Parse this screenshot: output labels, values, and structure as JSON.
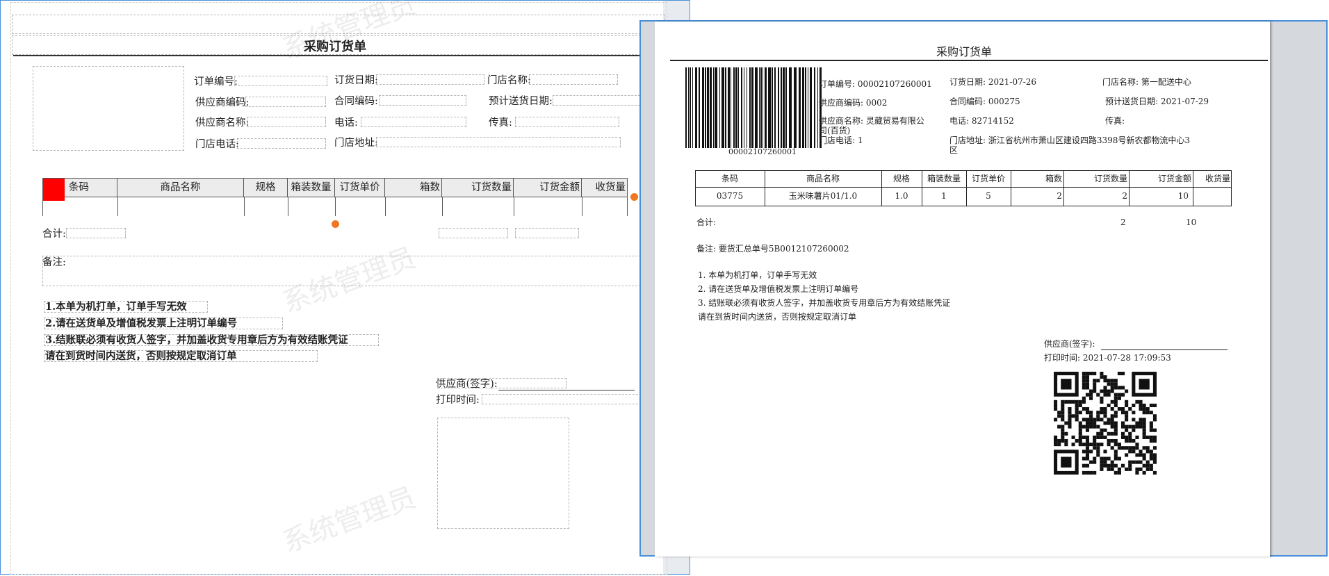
{
  "designer": {
    "title": "采购订货单",
    "watermark": "系统管理员",
    "header_fields": {
      "order_no": "订单编号:",
      "order_date": "订货日期:",
      "store_name": "门店名称:",
      "supplier_code": "供应商编码:",
      "contract_code": "合同编码:",
      "expected_date": "预计送货日期:",
      "supplier_name": "供应商名称:",
      "phone": "电话:",
      "fax": "传真:",
      "store_phone": "门店电话:",
      "store_address": "门店地址:"
    },
    "columns": [
      "条码",
      "商品名称",
      "规格",
      "箱装数量",
      "订货单价",
      "箱数",
      "订货数量",
      "订货金额",
      "收货量"
    ],
    "total_label": "合计:",
    "remark_label": "备注:",
    "notes": [
      "1.本单为机打单，订单手写无效",
      "2.请在送货单及增值税发票上注明订单编号",
      "3.结账联必须有收货人签字，并加盖收货专用章后方为有效结账凭证",
      "请在到货时间内送货，否则按规定取消订单"
    ],
    "supplier_sign": "供应商(签字):",
    "print_time": "打印时间:"
  },
  "preview": {
    "title": "采购订货单",
    "barcode_number": "00002107260001",
    "fields": {
      "order_no": "订单编号: 00002107260001",
      "order_date": "订货日期: 2021-07-26",
      "store_name": "门店名称: 第一配送中心",
      "supplier_code": "供应商编码: 0002",
      "contract_code": "合同编码: 000275",
      "expected_date": "预计送货日期: 2021-07-29",
      "supplier_name_1": "供应商名称: 灵藏贸易有限公",
      "supplier_name_2": "司(百货)",
      "phone": "电话: 82714152",
      "fax": "传真:",
      "store_phone": "门店电话: 1",
      "store_address_1": "门店地址: 浙江省杭州市萧山区建设四路3398号新农都物流中心3",
      "store_address_2": "区"
    },
    "columns": [
      "条码",
      "商品名称",
      "规格",
      "箱装数量",
      "订货单价",
      "箱数",
      "订货数量",
      "订货金额",
      "收货量"
    ],
    "rows": [
      [
        "03775",
        "玉米味薯片01/1.0",
        "1.0",
        "1",
        "5",
        "2",
        "2",
        "10",
        ""
      ]
    ],
    "total_label": "合计:",
    "total_qty": "2",
    "total_amount": "10",
    "remark": "备注: 要货汇总单号5B0012107260002",
    "notes": [
      "1. 本单为机打单，订单手写无效",
      "2. 请在送货单及增值税发票上注明订单编号",
      "3. 结账联必须有收货人签字，并加盖收货专用章后方为有效结账凭证",
      "请在到货时间内送货，否则按规定取消订单"
    ],
    "supplier_sign": "供应商(签字):",
    "print_time": "打印时间: 2021-07-28 17:09:53"
  },
  "colors": {
    "frame_border": "#4a90d9",
    "selection_marker": "#ff0000",
    "resize_handle": "#f07820",
    "preview_background": "#d5d8dc"
  },
  "icons": {
    "barcode": "barcode-image",
    "qr_code": "qr-code-image"
  }
}
